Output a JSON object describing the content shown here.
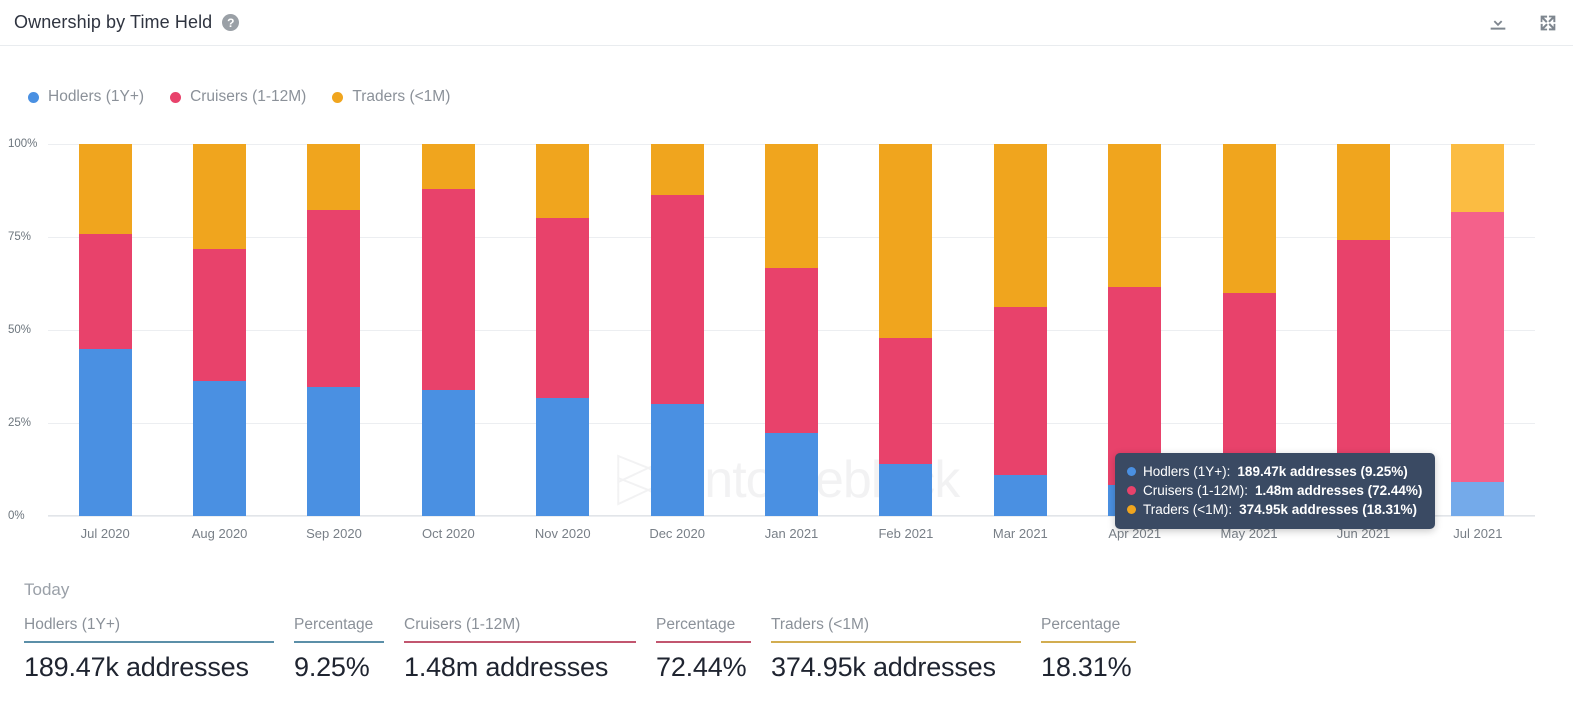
{
  "header": {
    "title": "Ownership by Time Held",
    "help_icon": "help-circle-icon",
    "download_icon": "download-icon",
    "expand_icon": "expand-icon"
  },
  "legend": [
    {
      "label": "Hodlers (1Y+)",
      "color": "#4a90e2"
    },
    {
      "label": "Cruisers (1-12M)",
      "color": "#e8426b"
    },
    {
      "label": "Traders (<1M)",
      "color": "#f0a51e"
    }
  ],
  "watermark": {
    "text": "intotheblock"
  },
  "tooltip": {
    "rows": [
      {
        "color": "#4a90e2",
        "name": "Hodlers (1Y+):",
        "value": "189.47k addresses (9.25%)"
      },
      {
        "color": "#e8426b",
        "name": "Cruisers (1-12M):",
        "value": "1.48m addresses (72.44%)"
      },
      {
        "color": "#f0a51e",
        "name": "Traders (<1M):",
        "value": "374.95k addresses (18.31%)"
      }
    ]
  },
  "footer": {
    "period_label": "Today",
    "percentage_label": "Percentage",
    "stats": [
      {
        "label": "Hodlers (1Y+)",
        "value": "189.47k addresses",
        "pct_label": "Percentage",
        "pct_value": "9.25%",
        "rule_color": "#5b8fa8"
      },
      {
        "label": "Cruisers (1-12M)",
        "value": "1.48m addresses",
        "pct_label": "Percentage",
        "pct_value": "72.44%",
        "rule_color": "#c2566f"
      },
      {
        "label": "Traders (<1M)",
        "value": "374.95k addresses",
        "pct_label": "Percentage",
        "pct_value": "18.31%",
        "rule_color": "#d2ad50"
      }
    ]
  },
  "chart_data": {
    "type": "bar",
    "stacked": true,
    "title": "Ownership by Time Held",
    "xlabel": "",
    "ylabel": "",
    "ylim": [
      0,
      100
    ],
    "ytick_labels": [
      "0%",
      "25%",
      "50%",
      "75%",
      "100%"
    ],
    "ytick_values": [
      0,
      25,
      50,
      75,
      100
    ],
    "grid": true,
    "legend_position": "top-left",
    "unit": "percent",
    "categories": [
      "Jul 2020",
      "Aug 2020",
      "Sep 2020",
      "Oct 2020",
      "Nov 2020",
      "Dec 2020",
      "Jan 2021",
      "Feb 2021",
      "Mar 2021",
      "Apr 2021",
      "May 2021",
      "Jun 2021",
      "Jul 2021"
    ],
    "series": [
      {
        "name": "Hodlers (1Y+)",
        "color": "#4a90e2",
        "values": [
          44.8,
          36.3,
          34.6,
          33.8,
          31.6,
          30.1,
          22.2,
          14.0,
          10.9,
          8.4,
          0.0,
          0.0,
          9.25
        ]
      },
      {
        "name": "Cruisers (1-12M)",
        "color": "#e8426b",
        "values": [
          31.0,
          35.6,
          47.6,
          54.2,
          48.4,
          56.3,
          44.6,
          33.9,
          45.2,
          53.2,
          60.0,
          74.2,
          72.44
        ]
      },
      {
        "name": "Traders (<1M)",
        "color": "#f0a51e",
        "values": [
          24.2,
          28.1,
          17.8,
          12.0,
          20.0,
          13.6,
          33.2,
          52.1,
          43.9,
          38.4,
          40.0,
          25.8,
          18.31
        ]
      }
    ],
    "highlighted_category": "Jul 2021",
    "highlight_colors": {
      "Hodlers (1Y+)": "#74aaea",
      "Cruisers (1-12M)": "#f4618b",
      "Traders (<1M)": "#fbbc42"
    }
  }
}
